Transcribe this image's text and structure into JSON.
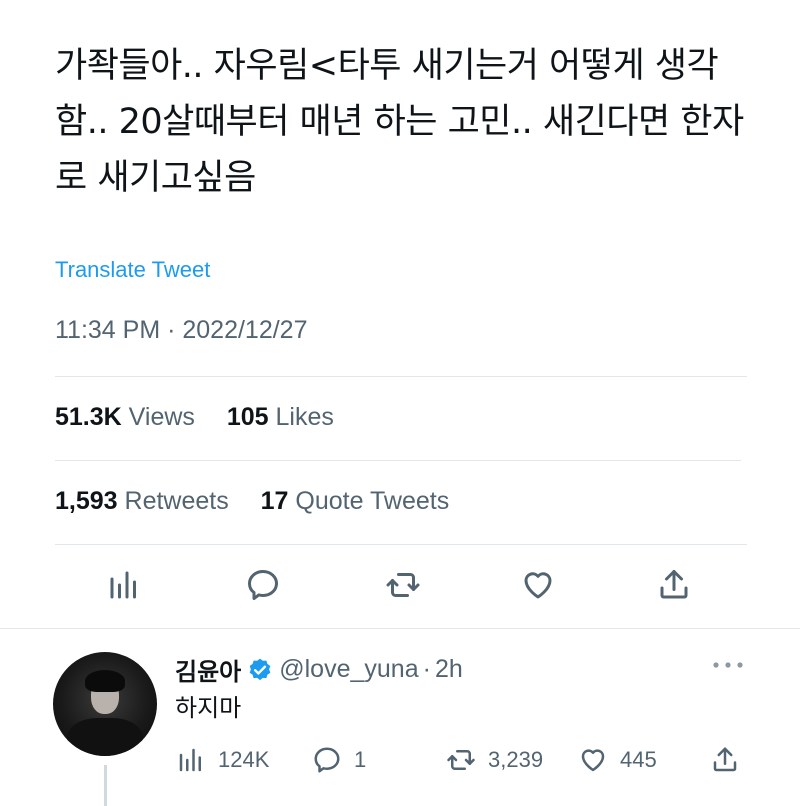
{
  "tweet": {
    "text": "가좍들아.. 자우림<타투 새기는거 어떻게 생각함.. 20살때부터 매년 하는 고민.. 새긴다면 한자로 새기고싶음",
    "translate_label": "Translate Tweet",
    "timestamp": "11:34 PM · 2022/12/27",
    "stats": {
      "views_count": "51.3K",
      "views_label": "Views",
      "likes_count": "105",
      "likes_label": "Likes",
      "retweets_count": "1,593",
      "retweets_label": "Retweets",
      "quotes_count": "17",
      "quotes_label": "Quote Tweets"
    },
    "actions": [
      "analytics-icon",
      "reply-icon",
      "retweet-icon",
      "like-icon",
      "share-icon"
    ]
  },
  "reply": {
    "name": "김윤아",
    "verified": true,
    "handle": "@love_yuna",
    "separator": "·",
    "time": "2h",
    "text": "하지마",
    "stats": {
      "views": "124K",
      "replies": "1",
      "retweets": "3,239",
      "likes": "445"
    }
  },
  "colors": {
    "accent": "#1d9bf0",
    "text_primary": "#0f1419",
    "text_secondary": "#536471",
    "divider": "#e1e6ea"
  }
}
